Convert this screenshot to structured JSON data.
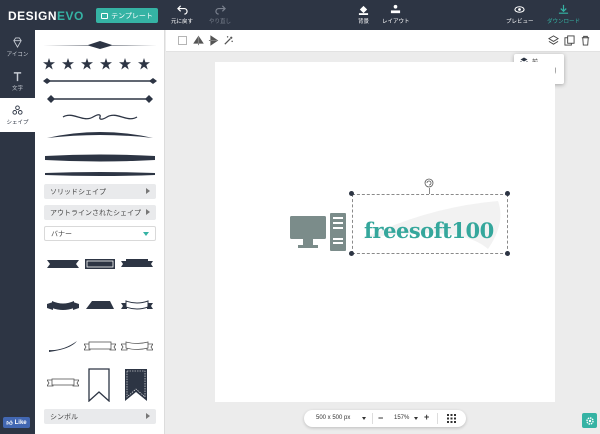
{
  "app": {
    "logo_part1": "DESIGN",
    "logo_part2": "EVO"
  },
  "header": {
    "template_label": "テンプレート",
    "undo_label": "元に戻す",
    "redo_label": "やり直し",
    "background_label": "背景",
    "layout_label": "レイアウト",
    "preview_label": "プレビュー",
    "download_label": "ダウンロード"
  },
  "left_tabs": [
    {
      "label": "アイコン",
      "icon": "diamond-icon"
    },
    {
      "label": "文字",
      "icon": "text-icon"
    },
    {
      "label": "シェイプ",
      "icon": "shapes-icon"
    }
  ],
  "facebook": {
    "like_label": "Like"
  },
  "shapes_panel": {
    "solid_shapes_label": "ソリッドシェイプ",
    "outline_shapes_label": "アウトラインされたシェイプ",
    "banner_label": "バナー",
    "symbol_label": "シンボル"
  },
  "layer_menu": {
    "front_label": "前",
    "back_label": "後"
  },
  "canvas": {
    "logo_text": "freesoft100"
  },
  "bottom_bar": {
    "size_label": "500 x 500 px",
    "zoom_label": "157%"
  },
  "colors": {
    "dark": "#2d3544",
    "accent": "#35b3a4",
    "logo_text": "#35a79c",
    "computer_icon": "#7b8c8a"
  }
}
